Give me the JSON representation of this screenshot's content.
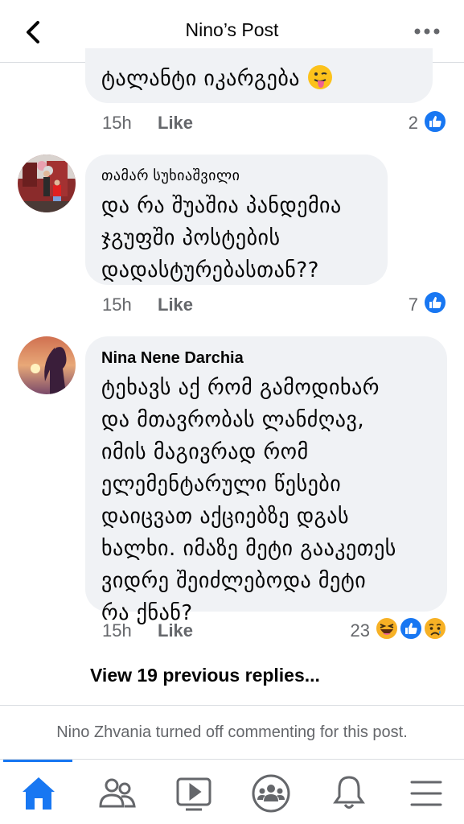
{
  "header": {
    "title": "Nino’s Post",
    "back_icon": "chevron-left-icon",
    "more_icon": "more-horizontal-icon"
  },
  "comments": [
    {
      "text_lines": [
        "ტალანტი იკარგება"
      ],
      "emoji": "tongue-out-emoji",
      "time": "15h",
      "like_label": "Like",
      "reaction_count": "2"
    },
    {
      "author": "თამარ სუხიაშვილი",
      "text_lines": [
        "და რა შუაშია პანდემია",
        "ჯგუფში პოსტების",
        "დადასტურებასთან??"
      ],
      "time": "15h",
      "like_label": "Like",
      "reaction_count": "7"
    },
    {
      "author": "Nina Nene Darchia",
      "text_lines": [
        "ტეხავს აქ რომ გამოდიხარ",
        "და მთავრობას ლანძღავ,",
        "იმის მაგივრად რომ",
        "ელემენტარული წესები",
        "დაიცვათ აქციებზე დგას",
        "ხალხი. იმაზე მეტი გააკეთეს",
        "ვიდრე შეიძლებოდა მეტი",
        "რა ქნან?"
      ],
      "time": "15h",
      "like_label": "Like",
      "reaction_count": "23"
    }
  ],
  "view_previous": "View 19 previous replies...",
  "notice": {
    "name": "Nino Zhvania",
    "text": " turned off commenting for this post."
  },
  "tabs": [
    {
      "name": "home-icon",
      "active": true
    },
    {
      "name": "friends-icon",
      "active": false
    },
    {
      "name": "watch-icon",
      "active": false
    },
    {
      "name": "groups-icon",
      "active": false
    },
    {
      "name": "notifications-icon",
      "active": false
    },
    {
      "name": "menu-icon",
      "active": false
    }
  ],
  "colors": {
    "accent": "#1877f2",
    "bubble": "#f0f2f5",
    "secondary_text": "#65676b",
    "haha": "#f7b125"
  }
}
